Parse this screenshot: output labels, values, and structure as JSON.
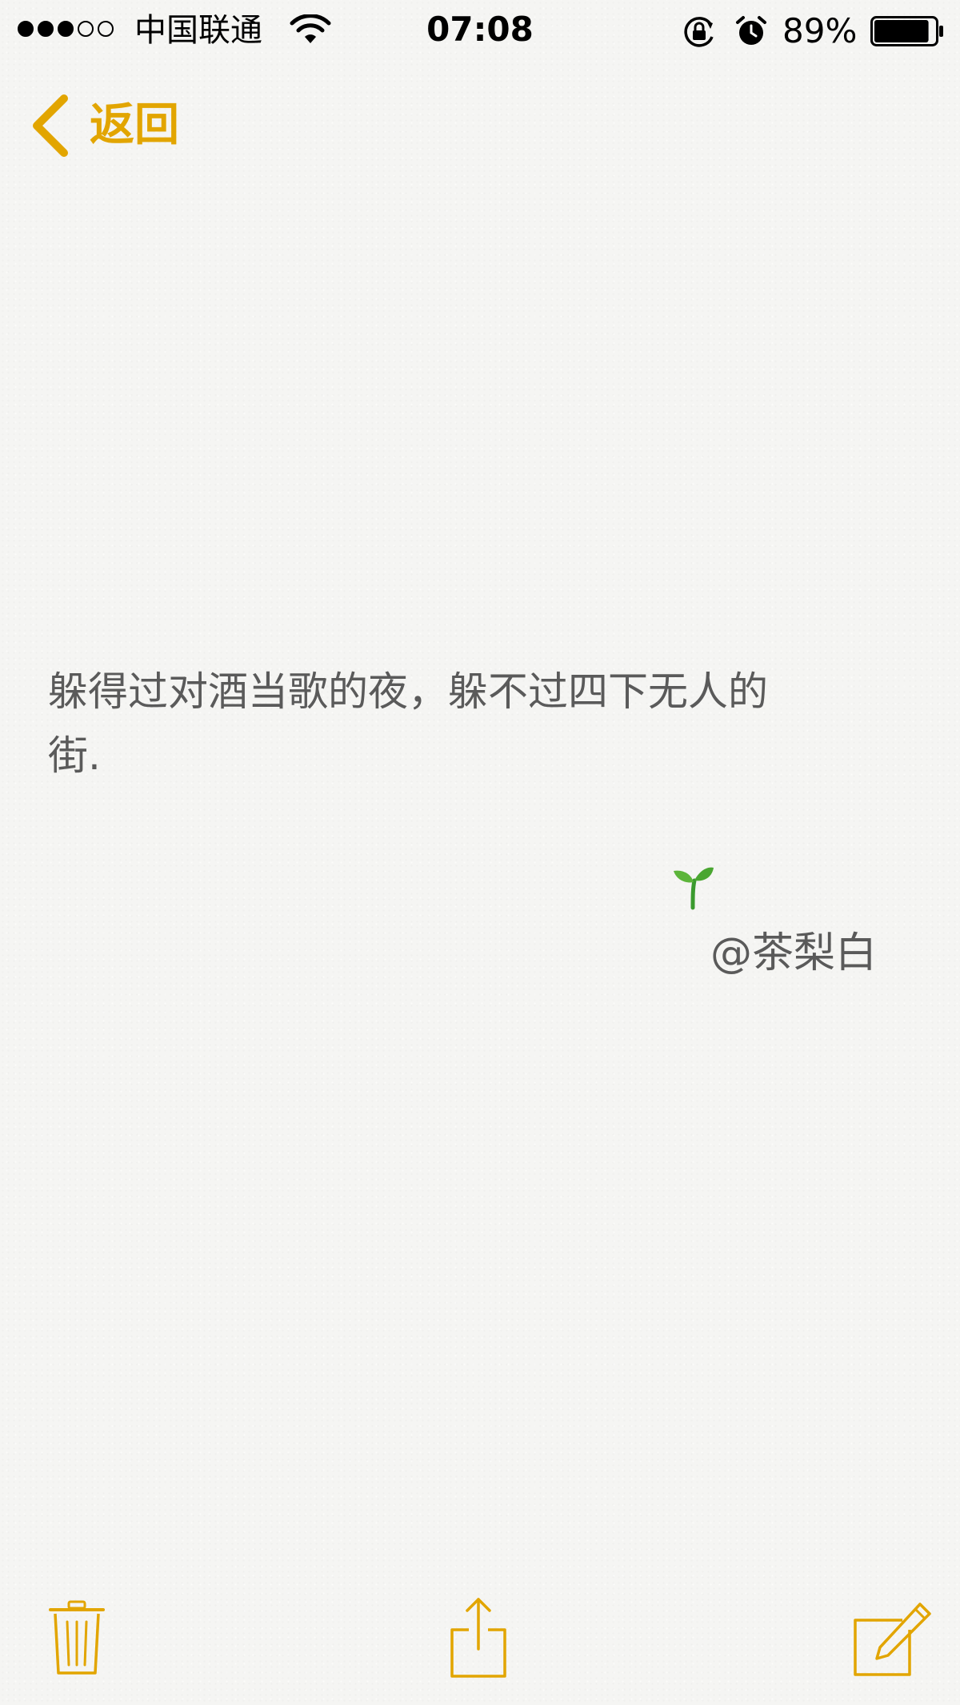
{
  "status_bar": {
    "signal_bars": [
      true,
      true,
      true,
      false,
      false
    ],
    "carrier": "中国联通",
    "time": "07:08",
    "battery_percent": "89%",
    "battery_level": 0.89,
    "icons": [
      "wifi-icon",
      "rotation-lock-icon",
      "alarm-icon",
      "battery-icon"
    ]
  },
  "nav": {
    "back_label": "返回"
  },
  "note": {
    "lines": [
      "躲得过对酒当歌的夜，躲不过四下无人的",
      "街."
    ],
    "emoji": "🌱",
    "signature": "@茶梨白"
  },
  "toolbar": {
    "icons": [
      "trash-icon",
      "share-icon",
      "compose-icon"
    ]
  },
  "colors": {
    "accent": "#e2a500",
    "text": "#5a5a5a",
    "background": "#f5f5f3"
  }
}
